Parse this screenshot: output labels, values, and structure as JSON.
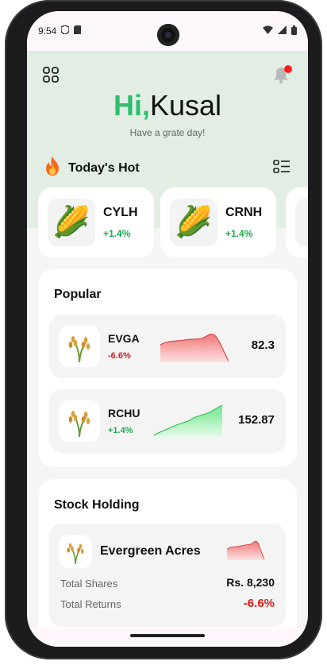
{
  "status_bar": {
    "time": "9:54"
  },
  "header": {
    "greeting_hi": "Hi,",
    "greeting_name": "Kusal",
    "tagline": "Have a grate day!"
  },
  "hot": {
    "title": "Today's Hot",
    "cards": [
      {
        "symbol": "CYLH",
        "change": "+1.4%",
        "icon": "corn-icon"
      },
      {
        "symbol": "CRNH",
        "change": "+1.4%",
        "icon": "corn-icon"
      }
    ]
  },
  "popular": {
    "title": "Popular",
    "items": [
      {
        "symbol": "EVGA",
        "change": "-6.6%",
        "price": "82.3",
        "trend": "down",
        "icon": "rice-plant-icon"
      },
      {
        "symbol": "RCHU",
        "change": "+1.4%",
        "price": "152.87",
        "trend": "up",
        "icon": "rice-plant-icon"
      }
    ]
  },
  "holding": {
    "title": "Stock Holding",
    "name": "Evergreen Acres",
    "shares_label": "Total Shares",
    "shares_value": "Rs. 8,230",
    "returns_label": "Total Returns",
    "returns_value": "-6.6%"
  },
  "colors": {
    "accent_green": "#2fbe6c",
    "positive": "#1faa52",
    "negative": "#d32020",
    "header_bg": "#e2ede4"
  }
}
